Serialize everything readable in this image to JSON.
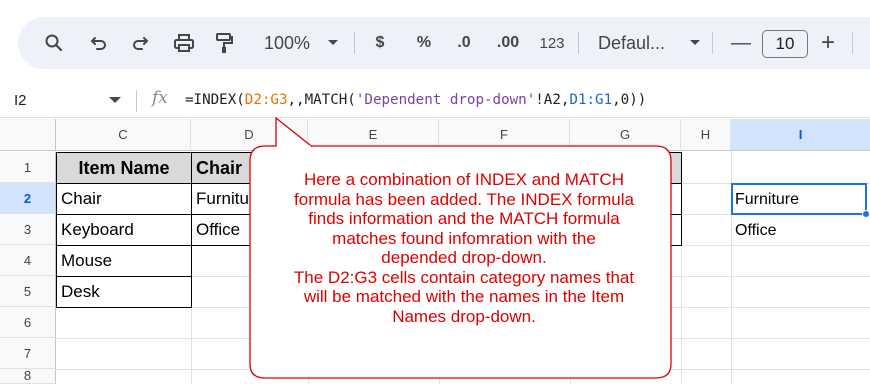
{
  "toolbar": {
    "zoom": "100%",
    "currency": "$",
    "percent": "%",
    "decrease_decimal": ".0",
    "increase_decimal": ".00",
    "number_format": "123",
    "font": "Defaul...",
    "font_size": "10",
    "minus": "—",
    "plus": "+"
  },
  "formula_bar": {
    "cell_ref": "I2",
    "fx_label": "fx",
    "parts": [
      "=INDEX(",
      "D2:G3",
      ",,MATCH(",
      "'Dependent drop-down'",
      "!A2,",
      "D1:G1",
      ",0))"
    ]
  },
  "columns": [
    "C",
    "D",
    "E",
    "F",
    "G",
    "H",
    "I"
  ],
  "rows": [
    "1",
    "2",
    "3",
    "4",
    "5",
    "6",
    "7",
    "8"
  ],
  "cells": {
    "C1": "Item Name",
    "D1": "Chair",
    "C2": "Chair",
    "D2": "Furniture",
    "C3": "Keyboard",
    "D3": "Office",
    "C4": "Mouse",
    "C5": "Desk",
    "I2": "Furniture",
    "I3": "Office"
  },
  "callout": {
    "lines": [
      "Here a combination of INDEX and MATCH",
      "formula has been added. The INDEX formula",
      "finds information and the MATCH formula",
      "matches found infomration with the",
      "depended drop-down.",
      "The D2:G3 cells contain category names that",
      "will be matched with the names in the Item",
      "Names drop-down."
    ],
    "color": "#e00000"
  },
  "colors": {
    "toolbar_bg": "#edf2fa",
    "selection": "#1a73e8",
    "header_fill": "#d9d9d9"
  }
}
